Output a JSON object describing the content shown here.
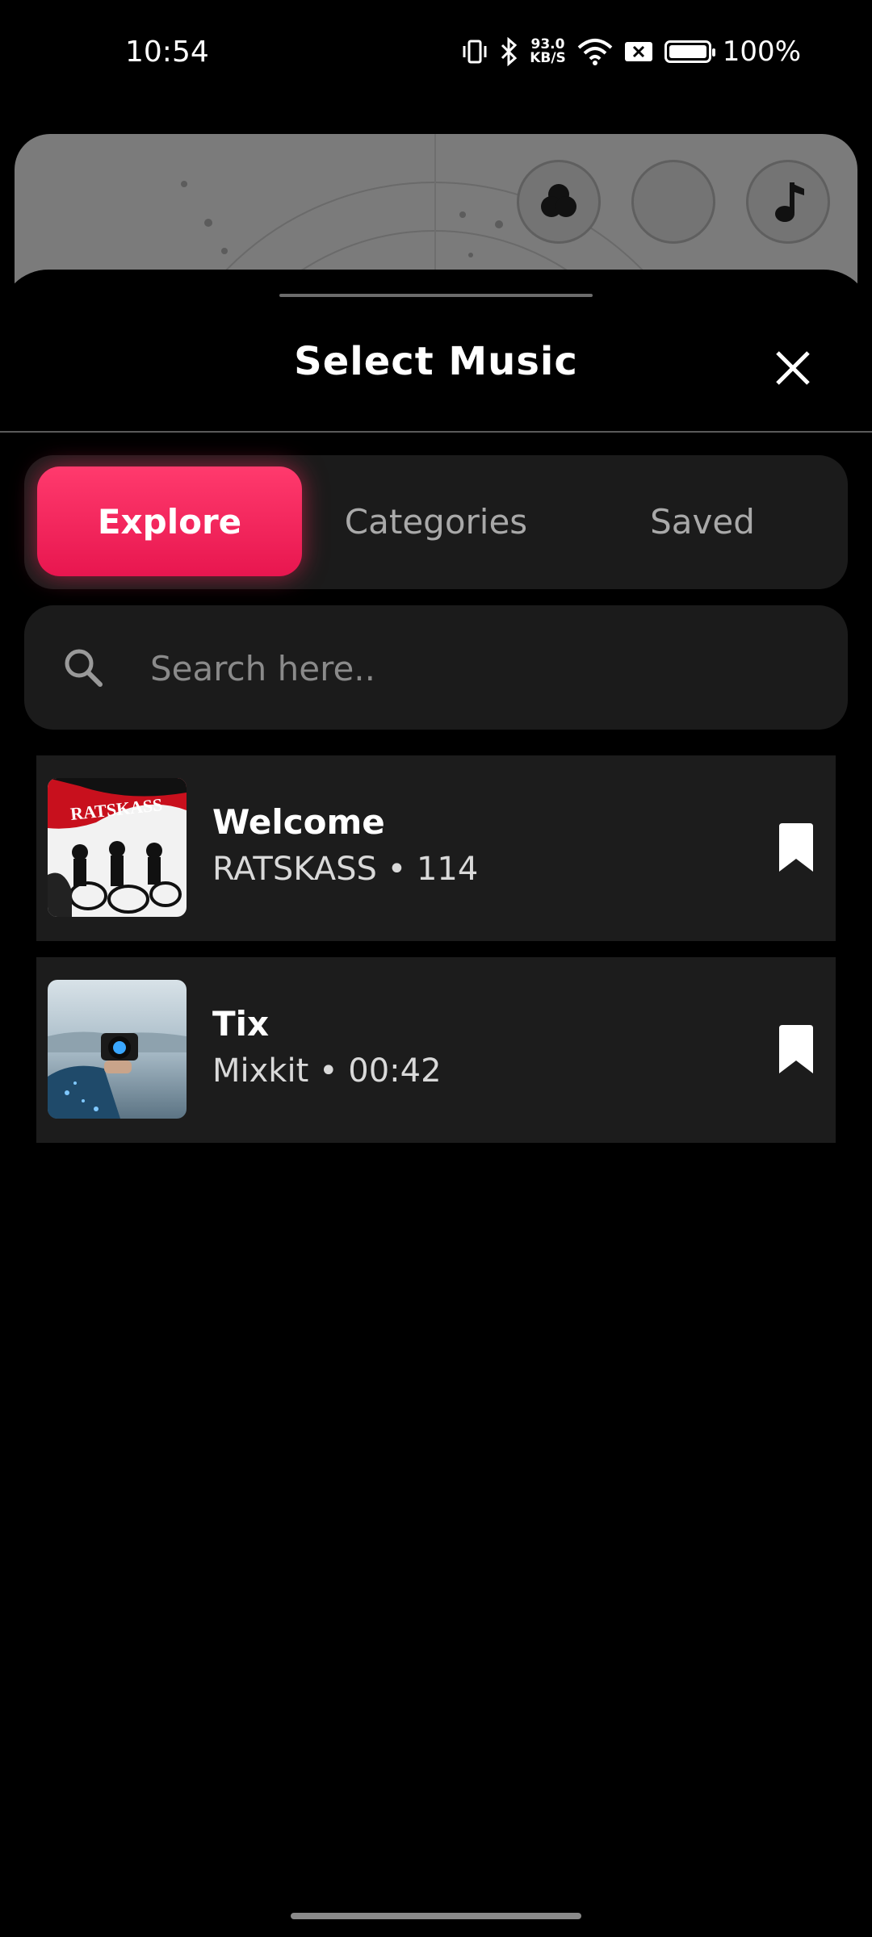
{
  "status_bar": {
    "time": "10:54",
    "net_speed_value": "93.0",
    "net_speed_unit": "KB/S",
    "battery": "100%"
  },
  "background_card": {
    "buttons": [
      "filters-icon",
      "blank-circle",
      "music-note-icon"
    ]
  },
  "sheet": {
    "title": "Select Music",
    "tabs": [
      {
        "label": "Explore",
        "active": true
      },
      {
        "label": "Categories",
        "active": false
      },
      {
        "label": "Saved",
        "active": false
      }
    ],
    "search": {
      "placeholder": "Search here.."
    },
    "tracks": [
      {
        "title": "Welcome",
        "subtitle": "RATSKASS • 114",
        "thumb_text": "RATSKASS"
      },
      {
        "title": "Tix",
        "subtitle": "Mixkit • 00:42"
      }
    ]
  },
  "colors": {
    "accent": "#f21e55",
    "background": "#000000",
    "surface": "#1b1b1b"
  }
}
